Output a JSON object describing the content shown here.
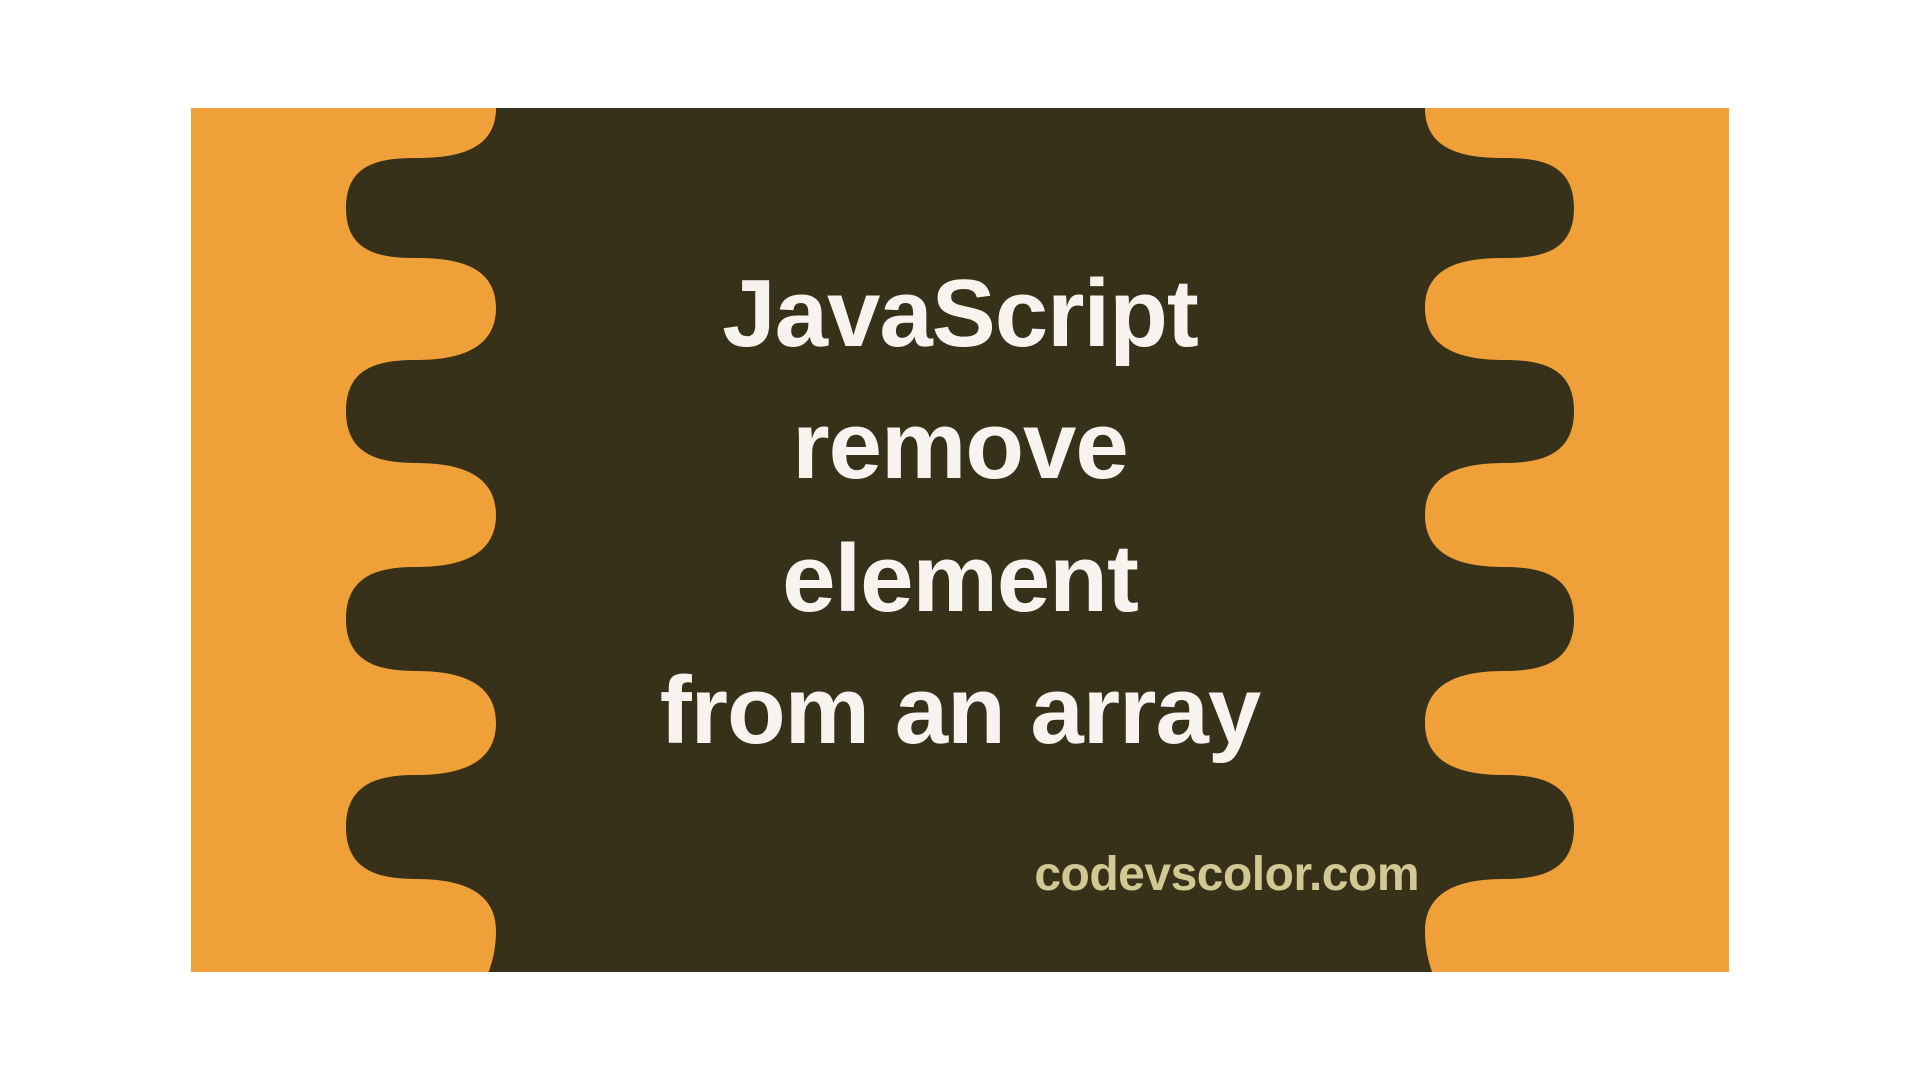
{
  "heading": {
    "line1": "JavaScript",
    "line2": "remove",
    "line3": "element",
    "line4": "from an array"
  },
  "brand": "codevscolor.com",
  "colors": {
    "background": "#efa038",
    "blob": "#38311a",
    "headingText": "#f7f4ef",
    "brandText": "#d2c894"
  }
}
